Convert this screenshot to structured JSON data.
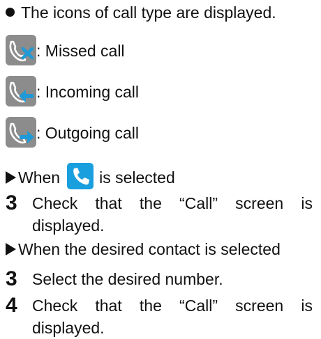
{
  "intro": "The icons of call type are displayed.",
  "call_types": [
    {
      "icon": "missed-call-icon",
      "label": ": Missed call"
    },
    {
      "icon": "incoming-call-icon",
      "label": ": Incoming call"
    },
    {
      "icon": "outgoing-call-icon",
      "label": ": Outgoing call"
    }
  ],
  "section_phone": {
    "before": "When",
    "icon": "phone-icon",
    "after": "is selected"
  },
  "step_phone": {
    "number": "3",
    "text": "Check that the “Call” screen is displayed."
  },
  "section_contact": "When the desired contact is selected",
  "steps_contact": [
    {
      "number": "3",
      "text": "Select the desired number."
    },
    {
      "number": "4",
      "text": "Check that the “Call” screen is displayed."
    }
  ],
  "colors": {
    "icon_bg": "#8c8c8c",
    "icon_glyph": "#ffffff",
    "missed_mark": "#1f9ad6",
    "arrow_mark": "#1f9ad6",
    "phone_button": "#1a9fde"
  }
}
